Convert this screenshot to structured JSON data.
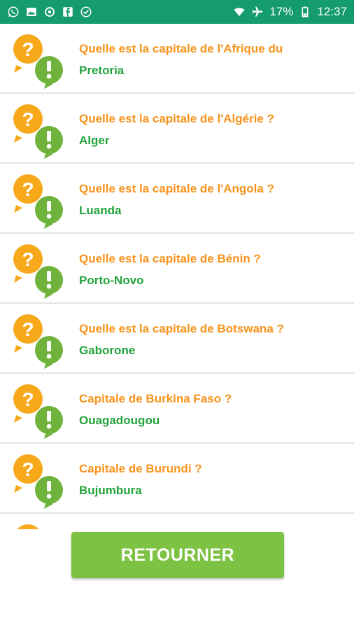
{
  "status_bar": {
    "notification_icons": [
      "whatsapp-icon",
      "gallery-icon",
      "sync-icon",
      "facebook-icon",
      "check-circle-icon"
    ],
    "battery_percent": "17%",
    "time": "12:37"
  },
  "colors": {
    "status_bar": "#149b6e",
    "question": "#f7941d",
    "answer": "#22a33b",
    "button": "#7dc242",
    "bubble_question": "#f7a81b",
    "bubble_answer": "#6fb33c"
  },
  "items": [
    {
      "question": "Quelle est la capitale de l'Afrique du",
      "answer": "Pretoria"
    },
    {
      "question": "Quelle est la capitale de l'Algérie ?",
      "answer": "Alger"
    },
    {
      "question": "Quelle est la capitale de l'Angola ?",
      "answer": "Luanda"
    },
    {
      "question": "Quelle est la capitale de Bénin ?",
      "answer": "Porto-Novo"
    },
    {
      "question": "Quelle est la capitale de Botswana ?",
      "answer": "Gaborone"
    },
    {
      "question": "Capitale de Burkina Faso ?",
      "answer": "Ouagadougou"
    },
    {
      "question": "Capitale de Burundi ?",
      "answer": "Bujumbura"
    }
  ],
  "button": {
    "label": "RETOURNER"
  }
}
